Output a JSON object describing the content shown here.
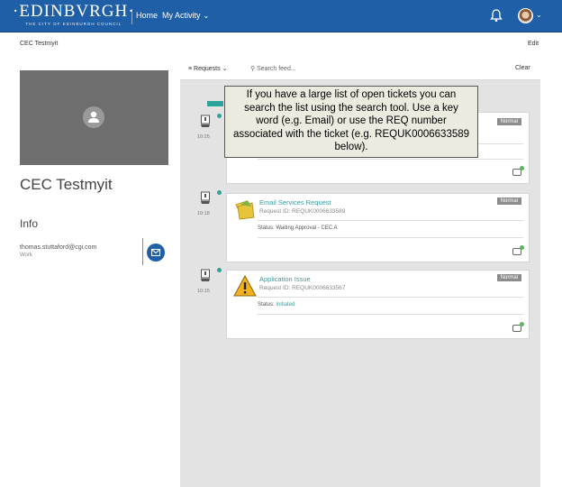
{
  "header": {
    "logo_main": "·EDINBVRGH·",
    "logo_sub": "THE CITY OF EDINBURGH COUNCIL",
    "nav": {
      "home": "Home",
      "my_activity": "My Activity"
    }
  },
  "breadcrumb": "CEC Testmyit",
  "edit_label": "Edit",
  "profile": {
    "name": "CEC Testmyit",
    "info_heading": "Info",
    "email": "thomas.stuttaford@cgi.com",
    "email_type": "Work"
  },
  "feed": {
    "filter_label": "Requests",
    "search_placeholder": "Search feed...",
    "clear_label": "Clear",
    "tooltip": "If you have a large list of open tickets you can search the list using the search tool. Use a key word (e.g. Email) or use the REQ number associated with the ticket (e.g. REQUK0006633589 below).",
    "items": [
      {
        "time": "10:25",
        "badge": "Normal",
        "title": "",
        "request_id": "",
        "status_label": "",
        "status_value": ""
      },
      {
        "time": "10:18",
        "badge": "Normal",
        "title": "Email Services Request",
        "request_id": "Request ID: REQUK0006633589",
        "status_label": "Status: Waiting Approval",
        "status_value": "CEC A"
      },
      {
        "time": "10:15",
        "badge": "Normal",
        "title": "Application Issue",
        "request_id": "Request ID: REQUK0006633567",
        "status_label": "Status:",
        "status_value": "Initiated"
      }
    ]
  },
  "colors": {
    "header_bg": "#1f5fa8",
    "accent_teal": "#2aa39a",
    "badge_grey": "#8c8c8c",
    "feed_bg": "#e3e3e3"
  },
  "icons": [
    "bell-icon",
    "avatar",
    "user-placeholder-icon",
    "mail-icon",
    "chevron-down-icon",
    "search-icon",
    "request-icon",
    "envelope-folder-icon",
    "warning-icon",
    "chat-icon"
  ]
}
